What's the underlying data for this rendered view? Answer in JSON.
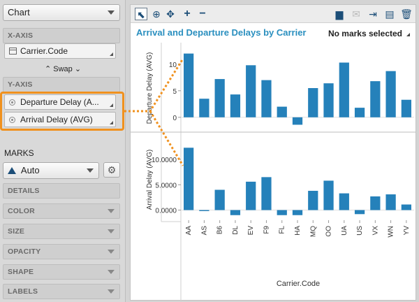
{
  "left_panel": {
    "chart_type": "Chart",
    "x_axis_title": "X-AXIS",
    "x_axis_field": "Carrier.Code",
    "swap_label": "Swap",
    "y_axis_title": "Y-AXIS",
    "y_fields": [
      "Departure Delay (A...",
      "Arrival Delay (AVG)"
    ],
    "marks_title": "MARKS",
    "marks_type": "Auto",
    "sections": [
      "DETAILS",
      "COLOR",
      "SIZE",
      "OPACITY",
      "SHAPE",
      "LABELS"
    ]
  },
  "toolbar": {
    "icons": [
      "select-icon",
      "zoom-icon",
      "pan-icon",
      "plus-icon",
      "minus-icon",
      "comment-icon",
      "mail-icon",
      "export-icon",
      "copy-icon",
      "trash-icon"
    ]
  },
  "status": {
    "selection": "No marks selected"
  },
  "colors": {
    "bar": "#2581ba",
    "highlight": "#f0911e",
    "title": "#2a8fbf"
  },
  "chart_data": [
    {
      "type": "bar",
      "title": "Arrival and Departure Delays by Carrier",
      "categories": [
        "AA",
        "AS",
        "B6",
        "DL",
        "EV",
        "F9",
        "FL",
        "HA",
        "MQ",
        "OO",
        "UA",
        "US",
        "VX",
        "WN",
        "YV"
      ],
      "xlabel": "Carrier.Code",
      "ylabel": "Departure Delay (AVG)",
      "values": [
        12,
        3.5,
        7.2,
        4.3,
        9.8,
        7,
        2,
        -1.4,
        5.5,
        6.4,
        10.3,
        1.8,
        6.8,
        8.7,
        3.3
      ],
      "yticks": [
        "0",
        "5",
        "10"
      ],
      "ylim": [
        -2,
        13
      ]
    },
    {
      "type": "bar",
      "title": "",
      "categories": [
        "AA",
        "AS",
        "B6",
        "DL",
        "EV",
        "F9",
        "FL",
        "HA",
        "MQ",
        "OO",
        "UA",
        "US",
        "VX",
        "WN",
        "YV"
      ],
      "xlabel": "Carrier.Code",
      "ylabel": "Arrival Delay (AVG)",
      "values": [
        12.3,
        -0.2,
        4,
        -1,
        5.6,
        6.5,
        -1,
        -1,
        3.8,
        5.8,
        3.3,
        -0.8,
        2.7,
        3.1,
        1.1
      ],
      "yticks": [
        "0.0000",
        "5.0000",
        "10.0000"
      ],
      "ylim": [
        -2,
        14
      ]
    }
  ]
}
